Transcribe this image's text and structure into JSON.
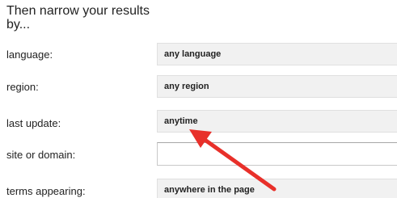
{
  "heading": "Then narrow your results by...",
  "rows": {
    "language": {
      "label": "language:",
      "value": "any language"
    },
    "region": {
      "label": "region:",
      "value": "any region"
    },
    "last_update": {
      "label": "last update:",
      "value": "anytime"
    },
    "site_or_domain": {
      "label": "site or domain:",
      "value": ""
    },
    "terms_appearing": {
      "label": "terms appearing:",
      "value": "anywhere in the page"
    }
  },
  "annotation": {
    "arrow_color": "#e8302a"
  }
}
